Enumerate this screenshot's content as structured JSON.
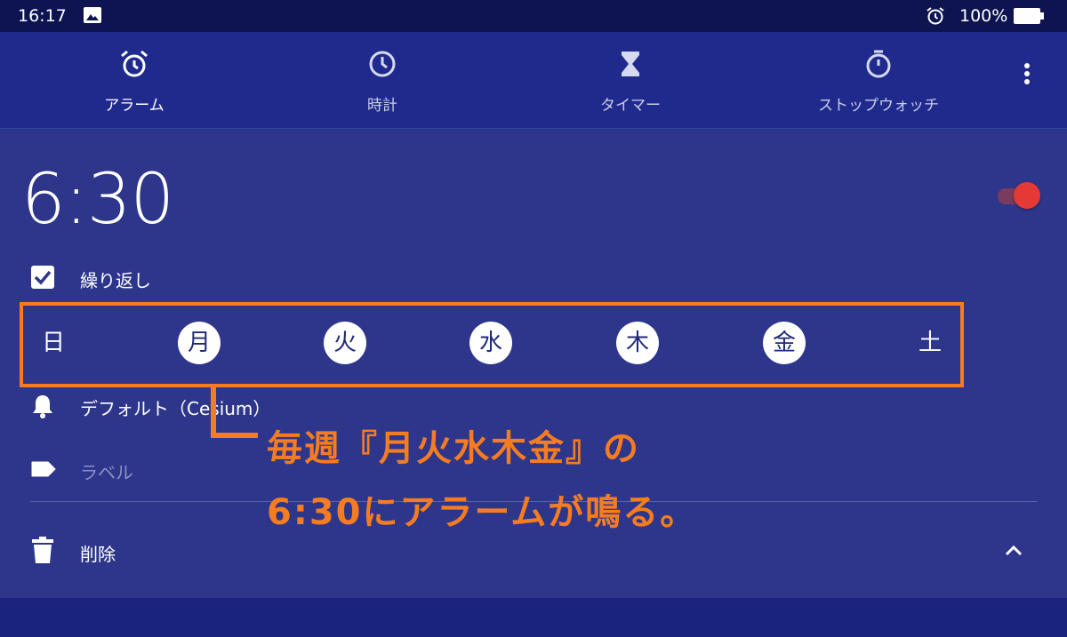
{
  "status_bar": {
    "time": "16:17",
    "battery": "100%"
  },
  "tabs": [
    {
      "label": "アラーム",
      "icon": "alarm-icon",
      "active": true
    },
    {
      "label": "時計",
      "icon": "clock-icon",
      "active": false
    },
    {
      "label": "タイマー",
      "icon": "hourglass-icon",
      "active": false
    },
    {
      "label": "ストップウォッチ",
      "icon": "stopwatch-icon",
      "active": false
    }
  ],
  "alarm": {
    "time": "6:30",
    "enabled": true,
    "repeat_label": "繰り返し",
    "repeat_checked": true,
    "days": [
      {
        "label": "日",
        "selected": false
      },
      {
        "label": "月",
        "selected": true
      },
      {
        "label": "火",
        "selected": true
      },
      {
        "label": "水",
        "selected": true
      },
      {
        "label": "木",
        "selected": true
      },
      {
        "label": "金",
        "selected": true
      },
      {
        "label": "土",
        "selected": false
      }
    ],
    "sound": "デフォルト（Cesium）",
    "label_placeholder": "ラベル",
    "delete_label": "削除"
  },
  "annotation": {
    "line1": "毎週『月火水木金』の",
    "line2": "6:30にアラームが鳴る。",
    "color": "#f57c20"
  },
  "colors": {
    "status_bar": "#0d1450",
    "tab_bar": "#1f2a8c",
    "card": "#2e368c",
    "toggle_thumb": "#e53935",
    "highlight": "#f57c20"
  }
}
